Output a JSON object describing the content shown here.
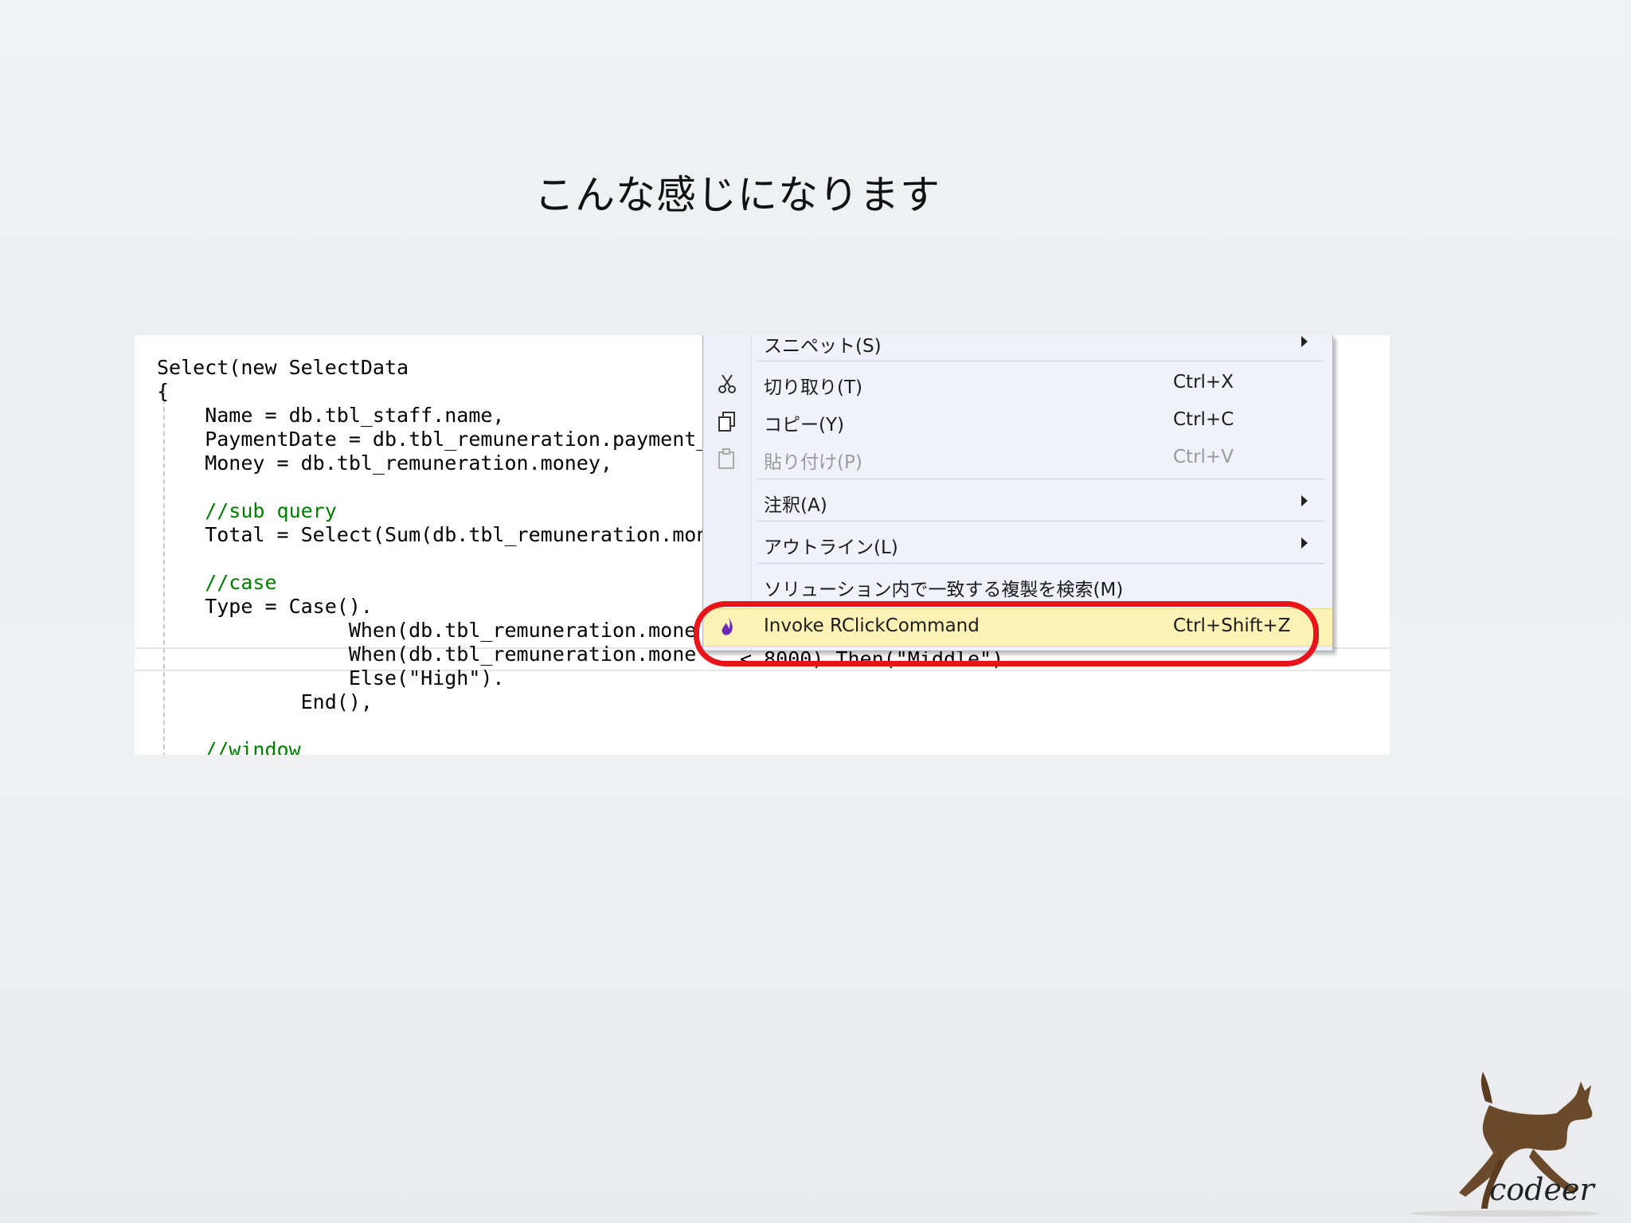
{
  "slide": {
    "title": "こんな感じになります"
  },
  "code": {
    "lines": [
      "Select(new SelectData",
      "{",
      "    Name = db.tbl_staff.name,",
      "    PaymentDate = db.tbl_remuneration.payment_",
      "    Money = db.tbl_remuneration.money,",
      "",
      "    //sub query",
      "    Total = Select(Sum(db.tbl_remuneration.mon",
      "",
      "    //case",
      "    Type = Case().",
      "                When(db.tbl_remuneration.mone",
      "                When(db.tbl_remuneration.mone",
      "                Else(\"High\").",
      "            End(),",
      "",
      "    //window"
    ],
    "behind_menu_fragment": "< 8000).Then(\"Middle\")."
  },
  "context_menu": {
    "items": [
      {
        "label": "スニペット(S)",
        "shortcut": "",
        "submenu": true,
        "icon": ""
      },
      {
        "label": "切り取り(T)",
        "shortcut": "Ctrl+X",
        "submenu": false,
        "icon": "scissors-icon"
      },
      {
        "label": "コピー(Y)",
        "shortcut": "Ctrl+C",
        "submenu": false,
        "icon": "copy-icon"
      },
      {
        "label": "貼り付け(P)",
        "shortcut": "Ctrl+V",
        "submenu": false,
        "icon": "paste-icon",
        "disabled": true
      },
      {
        "label": "注釈(A)",
        "shortcut": "",
        "submenu": true,
        "icon": ""
      },
      {
        "label": "アウトライン(L)",
        "shortcut": "",
        "submenu": true,
        "icon": ""
      },
      {
        "label": "ソリューション内で一致する複製を検索(M)",
        "shortcut": "",
        "submenu": false,
        "icon": ""
      },
      {
        "label": "Invoke RClickCommand",
        "shortcut": "Ctrl+Shift+Z",
        "submenu": false,
        "icon": "flame-icon",
        "highlighted": true
      }
    ]
  },
  "logo": {
    "text": "codeer"
  },
  "colors": {
    "highlight": "#fcf2b5",
    "annotation_oval": "#e8141a",
    "keyword": "#0000ff",
    "type": "#2b91af",
    "comment": "#008000",
    "string": "#a31515"
  }
}
